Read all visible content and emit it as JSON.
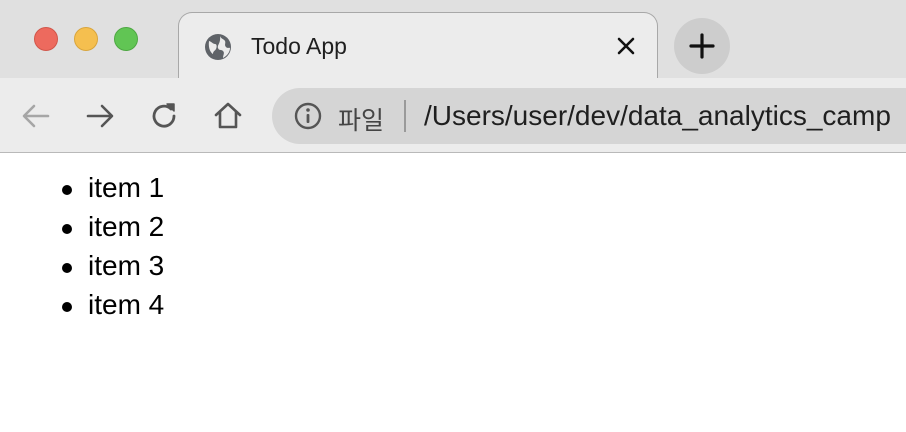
{
  "window": {
    "controls": [
      "close",
      "minimize",
      "maximize"
    ]
  },
  "tab": {
    "title": "Todo App",
    "icon": "globe-icon",
    "close_icon": "close-icon"
  },
  "toolbar": {
    "new_tab_icon": "plus-icon",
    "back_icon": "arrow-left-icon",
    "forward_icon": "arrow-right-icon",
    "reload_icon": "reload-icon",
    "home_icon": "home-icon"
  },
  "address_bar": {
    "info_icon": "info-icon",
    "scheme_label": "파일",
    "url": "/Users/user/dev/data_analytics_camp"
  },
  "page": {
    "items": [
      {
        "label": "item 1"
      },
      {
        "label": "item 2"
      },
      {
        "label": "item 3"
      },
      {
        "label": "item 4"
      }
    ]
  }
}
